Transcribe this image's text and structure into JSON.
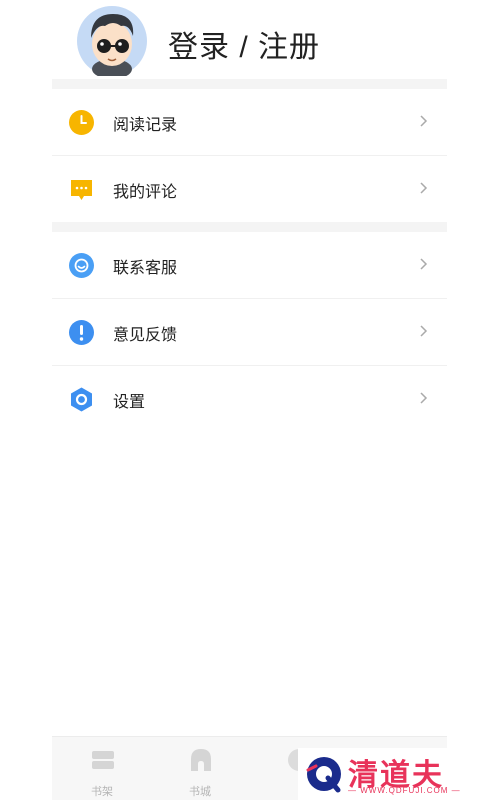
{
  "profile": {
    "login_label": "登录 / 注册"
  },
  "menu": {
    "items": [
      {
        "label": "阅读记录",
        "icon": "clock-icon",
        "color": "#f7b500"
      },
      {
        "label": "我的评论",
        "icon": "comment-icon",
        "color": "#f7b500"
      },
      {
        "label": "联系客服",
        "icon": "smile-icon",
        "color": "#4a9ff5"
      },
      {
        "label": "意见反馈",
        "icon": "exclamation-icon",
        "color": "#3d8ff0"
      },
      {
        "label": "设置",
        "icon": "settings-hex-icon",
        "color": "#3d8ff0"
      }
    ]
  },
  "tabbar": {
    "tabs": [
      {
        "label": "书架",
        "icon": "bookshelf-icon"
      },
      {
        "label": "书城",
        "icon": "bookstore-icon"
      }
    ]
  },
  "watermark": {
    "text": "清道夫",
    "url": "— WWW.QDFUJI.COM —"
  }
}
